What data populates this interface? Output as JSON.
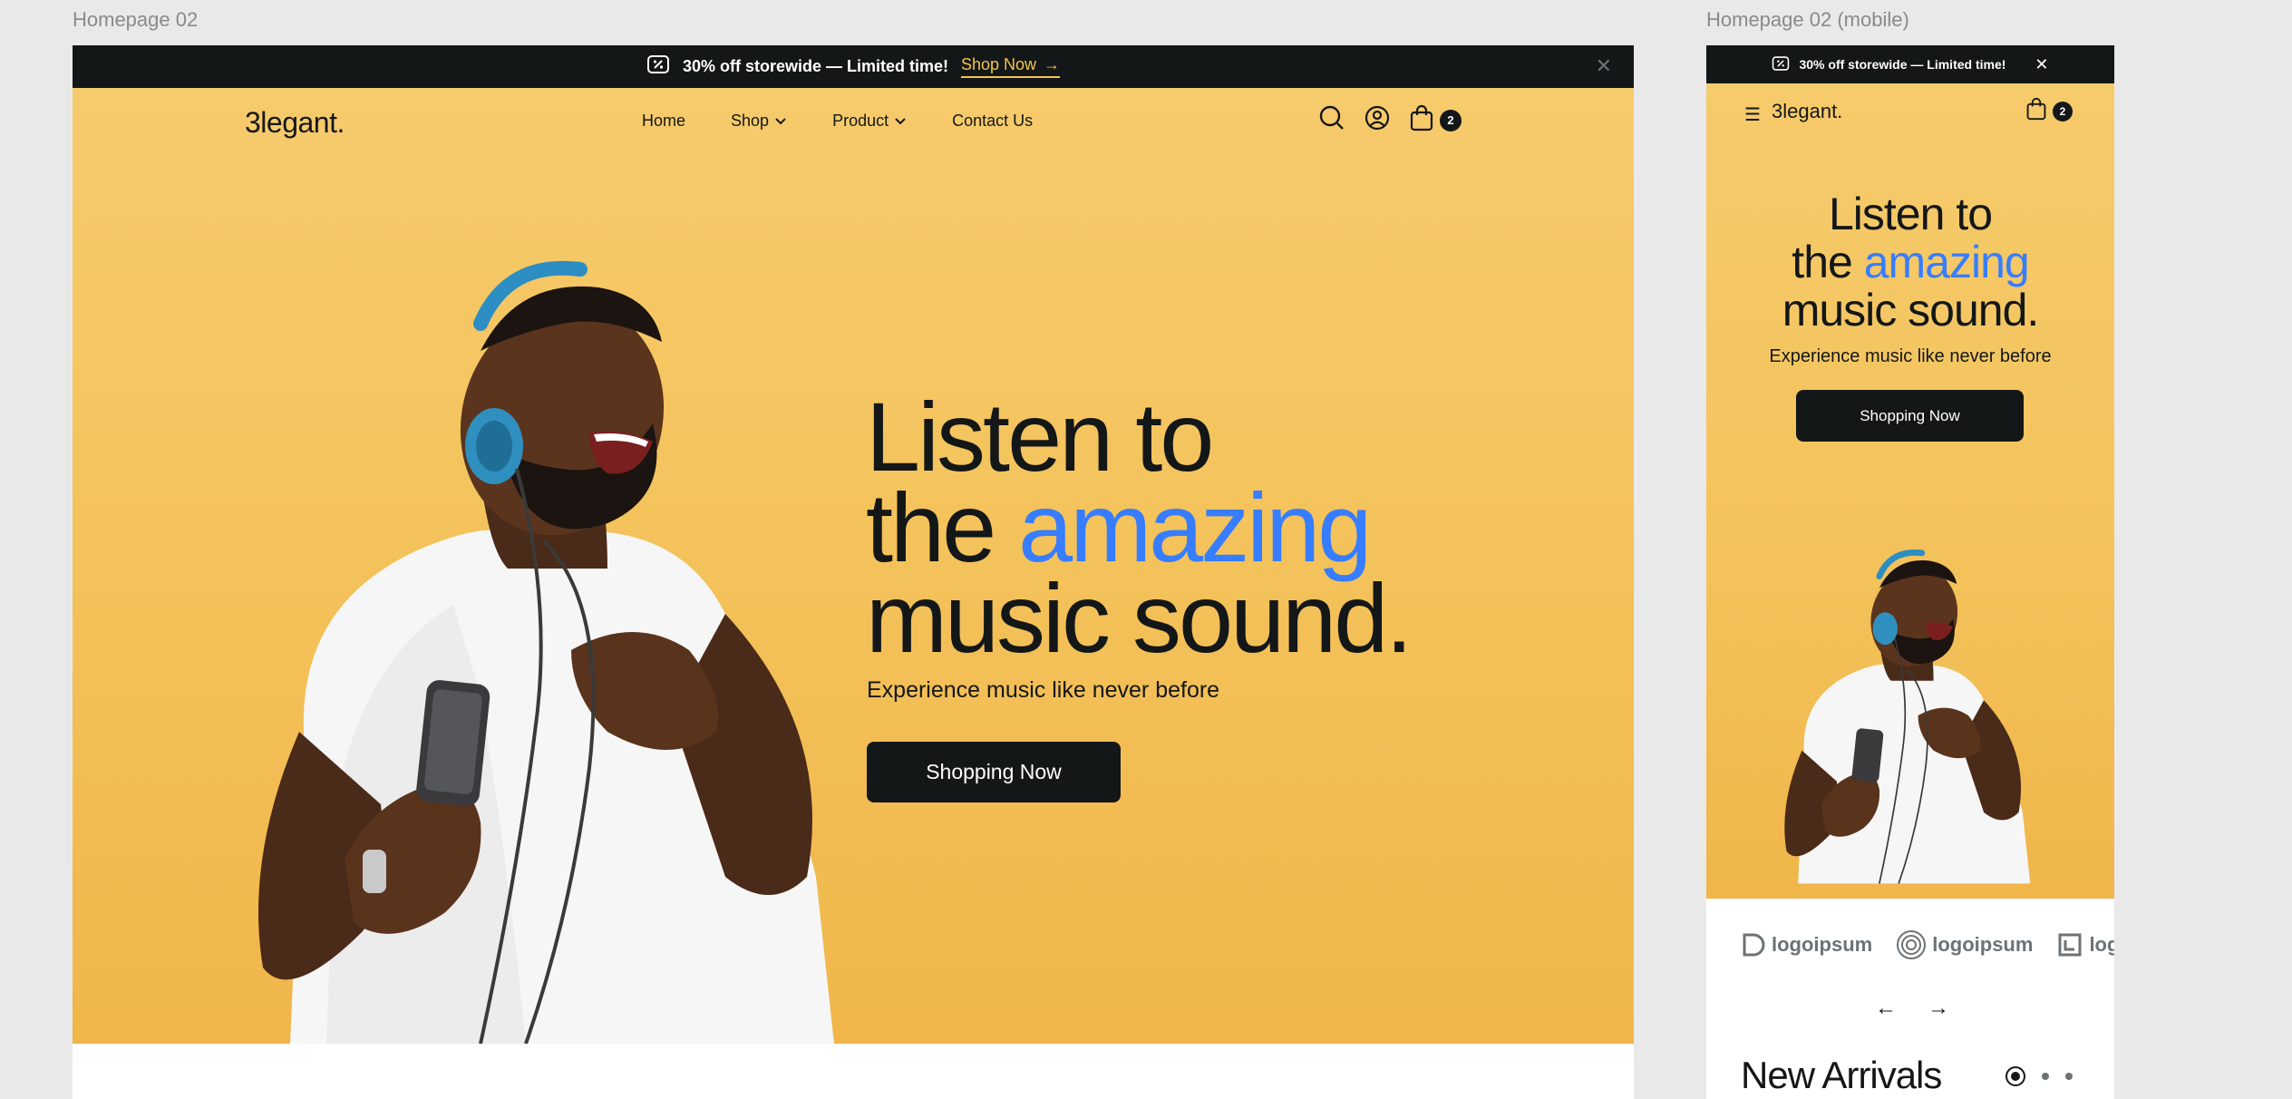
{
  "canvas": {
    "desktop_label": "Homepage 02",
    "mobile_label": "Homepage 02 (mobile)"
  },
  "promo": {
    "text": "30% off storewide — Limited time!",
    "cta": "Shop Now",
    "close_glyph": "✕"
  },
  "brand": {
    "logo": "3legant."
  },
  "nav": {
    "items": [
      {
        "label": "Home"
      },
      {
        "label": "Shop",
        "dropdown": true
      },
      {
        "label": "Product",
        "dropdown": true
      },
      {
        "label": "Contact Us"
      }
    ],
    "cart_count": "2"
  },
  "hero": {
    "line1": "Listen to",
    "line2_prefix": "the ",
    "line2_accent": "amazing",
    "line3": "music sound.",
    "subtitle": "Experience music like never before",
    "button": "Shopping Now"
  },
  "mobile": {
    "cart_count": "2",
    "logos": [
      "logoipsum",
      "logoipsum",
      "logoi"
    ],
    "section_title": "New Arrivals"
  },
  "colors": {
    "accent": "#377dff",
    "dark": "#141718",
    "hero_bg": "#f5c764",
    "promo_link": "#f2c44c"
  }
}
